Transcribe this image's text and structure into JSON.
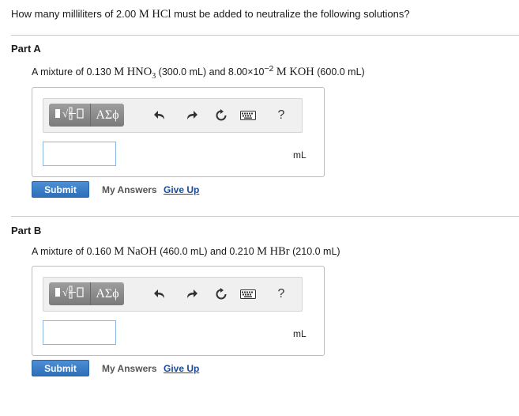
{
  "question": {
    "prefix": "How many milliliters of 2.00 ",
    "reagent_unit": "M",
    "reagent": "HCl",
    "suffix": " must be added to neutralize the following solutions?"
  },
  "parts": [
    {
      "title": "Part A",
      "prompt": {
        "lead": "A mixture of 0.130 ",
        "s1_unit": "M",
        "s1_formula": "HNO",
        "s1_sub": "3",
        "s1_volume": "(300.0 mL)",
        "mid": " and 8.00×10",
        "exp": "−2",
        "s2_unit": "M",
        "s2_formula": "KOH",
        "s2_volume": "(600.0 mL)"
      },
      "answer": {
        "value": "",
        "placeholder": ""
      },
      "unit": "mL",
      "submit_label": "Submit",
      "my_answers_label": "My Answers",
      "give_up_label": "Give Up"
    },
    {
      "title": "Part B",
      "prompt": {
        "lead": "A mixture of 0.160 ",
        "s1_unit": "M",
        "s1_formula": "NaOH",
        "s1_volume": "(460.0 mL)",
        "mid": " and 0.210 ",
        "s2_unit": "M",
        "s2_formula": "HBr",
        "s2_volume": "(210.0 mL)"
      },
      "answer": {
        "value": "",
        "placeholder": ""
      },
      "unit": "mL",
      "submit_label": "Submit",
      "my_answers_label": "My Answers",
      "give_up_label": "Give Up"
    }
  ],
  "toolbar": {
    "templates_icon": "templates-icon",
    "greek_label": "ΑΣϕ",
    "undo_icon": "undo-icon",
    "redo_icon": "redo-icon",
    "reset_icon": "reset-icon",
    "keyboard_icon": "keyboard-icon",
    "help_label": "?"
  },
  "colors": {
    "submit": "#2d6fb8",
    "give_up_link": "#1a4a9a",
    "input_border": "#8ab6e6",
    "toolbar_button": "#8a8a8a"
  }
}
